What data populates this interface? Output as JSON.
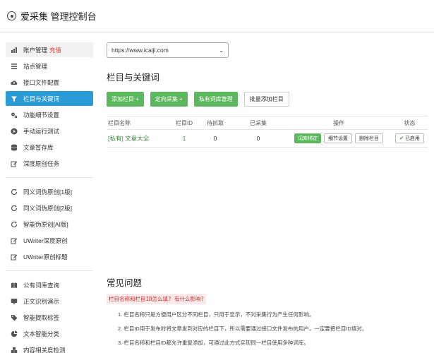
{
  "header": {
    "title": "爱采集 管理控制台"
  },
  "sidebar": {
    "groups": [
      [
        {
          "label": "账户管理",
          "extra": "充值",
          "icon": "bar-chart-icon"
        },
        {
          "label": "站点管理",
          "icon": "list-icon"
        },
        {
          "label": "接口文件配置",
          "icon": "cloud-upload-icon"
        },
        {
          "label": "栏目与关键词",
          "icon": "filter-icon",
          "active": true
        },
        {
          "label": "功能细节设置",
          "icon": "gears-icon"
        },
        {
          "label": "手动运行测试",
          "icon": "play-circle-icon"
        },
        {
          "label": "文章暂存库",
          "icon": "database-icon"
        },
        {
          "label": "深度原创任务",
          "icon": "edit-icon"
        }
      ],
      [
        {
          "label": "同义词伪原创[1版]",
          "icon": "refresh-icon"
        },
        {
          "label": "同义词伪原创[2版]",
          "icon": "refresh-icon"
        },
        {
          "label": "智能伪原创[AI版]",
          "icon": "refresh-icon"
        },
        {
          "label": "UWriter深度原创",
          "icon": "edit-icon"
        },
        {
          "label": "UWriter原创标题",
          "icon": "edit-icon"
        }
      ],
      [
        {
          "label": "公有词库查询",
          "icon": "book-icon"
        },
        {
          "label": "正文识别演示",
          "icon": "monitor-icon"
        },
        {
          "label": "智能提取标签",
          "icon": "tag-icon"
        },
        {
          "label": "文本智能分类",
          "icon": "pie-chart-icon"
        },
        {
          "label": "内容相关度检测",
          "icon": "cubes-icon"
        }
      ]
    ]
  },
  "main": {
    "site_select": "https://www.icaiji.com",
    "section_title": "栏目与关键词",
    "buttons": {
      "add": "添加栏目 +",
      "targeted": "定向采集 +",
      "private_dict": "私有词库管理",
      "batch_add": "批量添加栏目"
    },
    "table": {
      "headers": {
        "name": "栏目名称",
        "id": "栏目ID",
        "pending": "待抓取",
        "collected": "已采集",
        "ops": "操作",
        "status": "状态"
      },
      "rows": [
        {
          "name": "[私有] 文章大全",
          "id": "1",
          "pending": "0",
          "collected": "0",
          "ops": {
            "bind": "词库绑定",
            "detail": "细节设置",
            "delete": "删除栏目"
          },
          "status": "已启用"
        }
      ]
    }
  },
  "faq": {
    "title": "常见问题",
    "question": "栏目名称和栏目ID怎么填? 有什么影响?",
    "answers": [
      "1. 栏目名称只是方便用户区分不同栏目，只用于显示，不对采集行为产生任何影响。",
      "2. 栏目ID用于发布时将文章发到对应的栏目下，所以需要通过接口文件发布的用户，一定要把栏目ID填对。",
      "3. 栏目名称和栏目ID都允许重复添加，可通过此方式实现同一栏目使用多种词库。"
    ]
  }
}
